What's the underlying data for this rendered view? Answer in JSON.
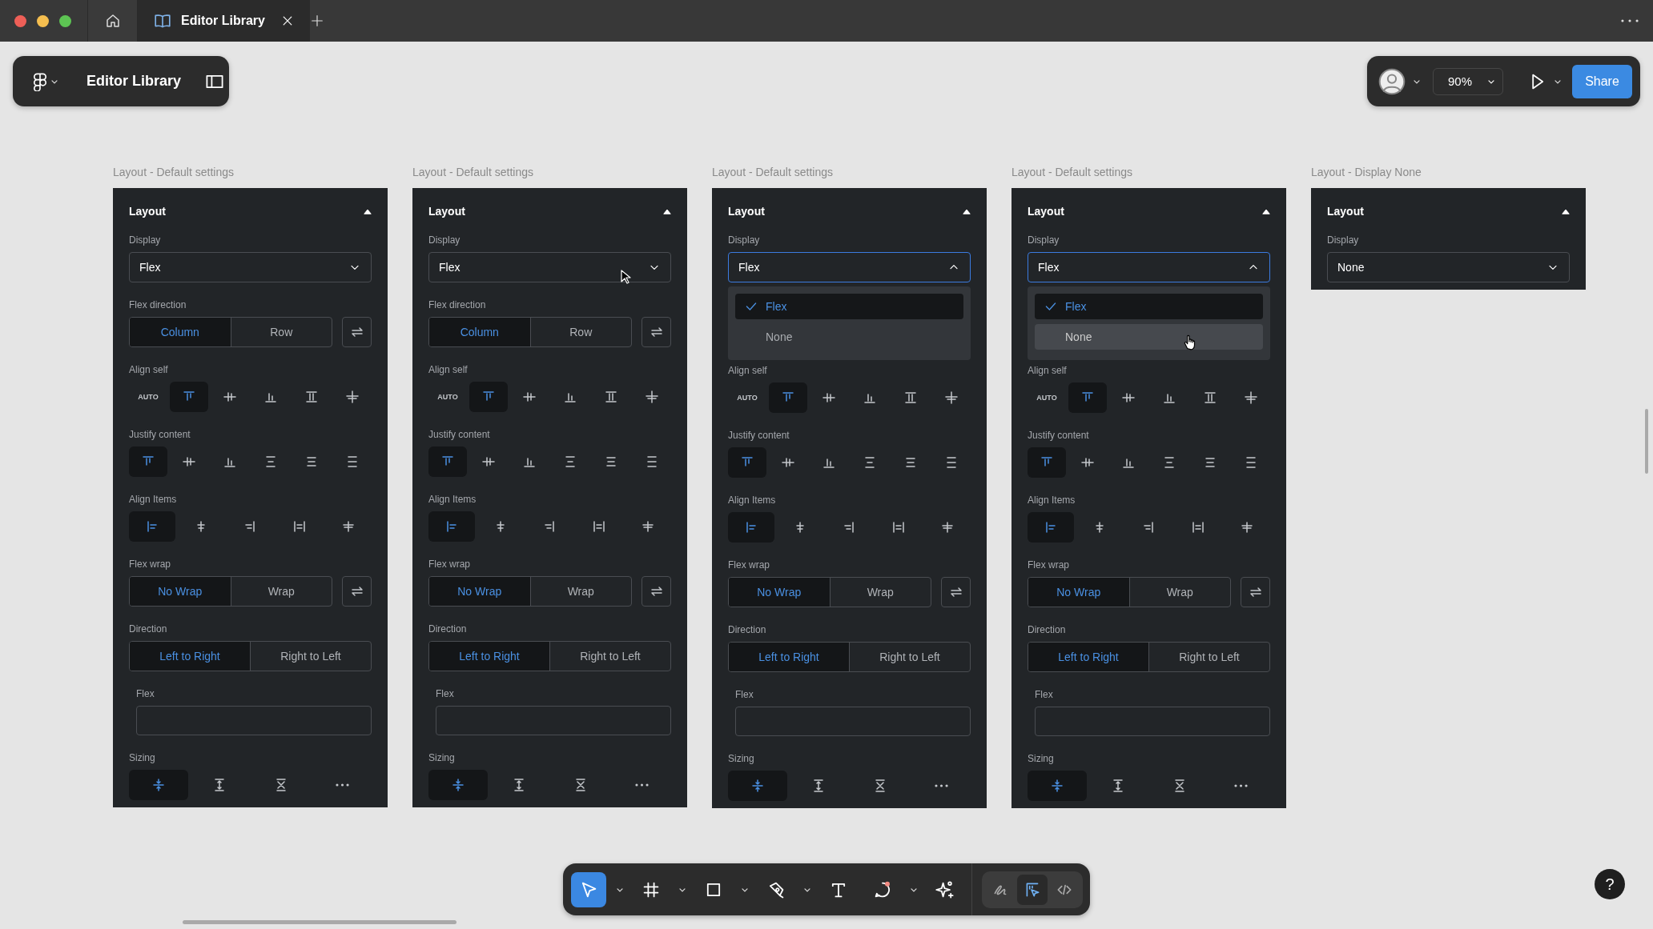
{
  "browser_tabs": [
    {
      "kind": "home",
      "selected": false
    },
    {
      "kind": "file",
      "label": "Editor Library",
      "selected": true
    }
  ],
  "file_bar": {
    "title": "Editor Library"
  },
  "share_bar": {
    "zoom": "90%",
    "share": "Share"
  },
  "panels": [
    {
      "caption": "Layout - Default settings",
      "title": "Layout",
      "expanded": true,
      "display": {
        "label": "Display",
        "value": "Flex",
        "open": false
      },
      "sections": [
        {
          "kind": "segmented",
          "label": "Flex direction",
          "swap": true,
          "options": [
            {
              "label": "Column",
              "selected": true
            },
            {
              "label": "Row",
              "selected": false
            }
          ]
        },
        {
          "kind": "icons",
          "label": "Align self",
          "items": [
            {
              "kind": "text",
              "label": "AUTO",
              "selected": false
            },
            {
              "kind": "align-top",
              "selected": true
            },
            {
              "kind": "align-middle",
              "selected": false
            },
            {
              "kind": "align-bottom",
              "selected": false
            },
            {
              "kind": "stretch",
              "selected": false
            },
            {
              "kind": "baseline",
              "selected": false
            }
          ]
        },
        {
          "kind": "icons",
          "label": "Justify content",
          "items": [
            {
              "kind": "align-top",
              "selected": true
            },
            {
              "kind": "align-middle",
              "selected": false
            },
            {
              "kind": "align-bottom",
              "selected": false
            },
            {
              "kind": "space-between",
              "selected": false
            },
            {
              "kind": "space-around",
              "selected": false
            },
            {
              "kind": "space-evenly",
              "selected": false
            }
          ]
        },
        {
          "kind": "icons",
          "label": "Align Items",
          "items": [
            {
              "kind": "items-start",
              "selected": true
            },
            {
              "kind": "items-center",
              "selected": false
            },
            {
              "kind": "items-end",
              "selected": false
            },
            {
              "kind": "items-stretch",
              "selected": false
            },
            {
              "kind": "items-baseline",
              "selected": false
            }
          ]
        },
        {
          "kind": "segmented",
          "label": "Flex wrap",
          "swap": true,
          "options": [
            {
              "label": "No Wrap",
              "selected": true
            },
            {
              "label": "Wrap",
              "selected": false
            }
          ]
        },
        {
          "kind": "segmented",
          "label": "Direction",
          "swap": false,
          "options": [
            {
              "label": "Left to Right",
              "selected": true
            },
            {
              "label": "Right to Left",
              "selected": false
            }
          ]
        },
        {
          "kind": "field",
          "label": "Flex"
        },
        {
          "kind": "icons",
          "label": "Sizing",
          "items": [
            {
              "kind": "size-fit",
              "selected": true
            },
            {
              "kind": "size-hug",
              "selected": false
            },
            {
              "kind": "size-fill",
              "selected": false
            },
            {
              "kind": "more",
              "selected": false
            }
          ]
        }
      ]
    },
    {
      "caption": "Layout - Default settings",
      "title": "Layout",
      "expanded": true,
      "display": {
        "label": "Display",
        "value": "Flex",
        "open": false,
        "hovered": true
      },
      "sections": [
        {
          "kind": "segmented",
          "label": "Flex direction",
          "swap": true,
          "options": [
            {
              "label": "Column",
              "selected": true
            },
            {
              "label": "Row",
              "selected": false
            }
          ]
        },
        {
          "kind": "icons",
          "label": "Align self",
          "items": [
            {
              "kind": "text",
              "label": "AUTO",
              "selected": false
            },
            {
              "kind": "align-top",
              "selected": true
            },
            {
              "kind": "align-middle",
              "selected": false
            },
            {
              "kind": "align-bottom",
              "selected": false
            },
            {
              "kind": "stretch",
              "selected": false
            },
            {
              "kind": "baseline",
              "selected": false
            }
          ]
        },
        {
          "kind": "icons",
          "label": "Justify content",
          "items": [
            {
              "kind": "align-top",
              "selected": true
            },
            {
              "kind": "align-middle",
              "selected": false
            },
            {
              "kind": "align-bottom",
              "selected": false
            },
            {
              "kind": "space-between",
              "selected": false
            },
            {
              "kind": "space-around",
              "selected": false
            },
            {
              "kind": "space-evenly",
              "selected": false
            }
          ]
        },
        {
          "kind": "icons",
          "label": "Align Items",
          "items": [
            {
              "kind": "items-start",
              "selected": true
            },
            {
              "kind": "items-center",
              "selected": false
            },
            {
              "kind": "items-end",
              "selected": false
            },
            {
              "kind": "items-stretch",
              "selected": false
            },
            {
              "kind": "items-baseline",
              "selected": false
            }
          ]
        },
        {
          "kind": "segmented",
          "label": "Flex wrap",
          "swap": true,
          "options": [
            {
              "label": "No Wrap",
              "selected": true
            },
            {
              "label": "Wrap",
              "selected": false
            }
          ]
        },
        {
          "kind": "segmented",
          "label": "Direction",
          "swap": false,
          "options": [
            {
              "label": "Left to Right",
              "selected": true
            },
            {
              "label": "Right to Left",
              "selected": false
            }
          ]
        },
        {
          "kind": "field",
          "label": "Flex"
        },
        {
          "kind": "icons",
          "label": "Sizing",
          "items": [
            {
              "kind": "size-fit",
              "selected": true
            },
            {
              "kind": "size-hug",
              "selected": false
            },
            {
              "kind": "size-fill",
              "selected": false
            },
            {
              "kind": "more",
              "selected": false
            }
          ]
        }
      ]
    },
    {
      "caption": "Layout - Default settings",
      "title": "Layout",
      "expanded": true,
      "display": {
        "label": "Display",
        "value": "Flex",
        "open": true,
        "options": [
          {
            "label": "Flex",
            "selected": true,
            "hovered": false
          },
          {
            "label": "None",
            "selected": false,
            "hovered": false
          }
        ]
      },
      "sections": [
        {
          "kind": "icons",
          "label": "Align self",
          "items": [
            {
              "kind": "text",
              "label": "AUTO",
              "selected": false
            },
            {
              "kind": "align-top",
              "selected": true
            },
            {
              "kind": "align-middle",
              "selected": false
            },
            {
              "kind": "align-bottom",
              "selected": false
            },
            {
              "kind": "stretch",
              "selected": false
            },
            {
              "kind": "baseline",
              "selected": false
            }
          ]
        },
        {
          "kind": "icons",
          "label": "Justify content",
          "items": [
            {
              "kind": "align-top",
              "selected": true
            },
            {
              "kind": "align-middle",
              "selected": false
            },
            {
              "kind": "align-bottom",
              "selected": false
            },
            {
              "kind": "space-between",
              "selected": false
            },
            {
              "kind": "space-around",
              "selected": false
            },
            {
              "kind": "space-evenly",
              "selected": false
            }
          ]
        },
        {
          "kind": "icons",
          "label": "Align Items",
          "items": [
            {
              "kind": "items-start",
              "selected": true
            },
            {
              "kind": "items-center",
              "selected": false
            },
            {
              "kind": "items-end",
              "selected": false
            },
            {
              "kind": "items-stretch",
              "selected": false
            },
            {
              "kind": "items-baseline",
              "selected": false
            }
          ]
        },
        {
          "kind": "segmented",
          "label": "Flex wrap",
          "swap": true,
          "options": [
            {
              "label": "No Wrap",
              "selected": true
            },
            {
              "label": "Wrap",
              "selected": false
            }
          ]
        },
        {
          "kind": "segmented",
          "label": "Direction",
          "swap": false,
          "options": [
            {
              "label": "Left to Right",
              "selected": true
            },
            {
              "label": "Right to Left",
              "selected": false
            }
          ]
        },
        {
          "kind": "field",
          "label": "Flex"
        },
        {
          "kind": "icons",
          "label": "Sizing",
          "items": [
            {
              "kind": "size-fit",
              "selected": true
            },
            {
              "kind": "size-hug",
              "selected": false
            },
            {
              "kind": "size-fill",
              "selected": false
            },
            {
              "kind": "more",
              "selected": false
            }
          ]
        }
      ]
    },
    {
      "caption": "Layout - Default settings",
      "title": "Layout",
      "expanded": true,
      "display": {
        "label": "Display",
        "value": "Flex",
        "open": true,
        "options": [
          {
            "label": "Flex",
            "selected": true,
            "hovered": false
          },
          {
            "label": "None",
            "selected": false,
            "hovered": true
          }
        ]
      },
      "sections": [
        {
          "kind": "icons",
          "label": "Align self",
          "items": [
            {
              "kind": "text",
              "label": "AUTO",
              "selected": false
            },
            {
              "kind": "align-top",
              "selected": true
            },
            {
              "kind": "align-middle",
              "selected": false
            },
            {
              "kind": "align-bottom",
              "selected": false
            },
            {
              "kind": "stretch",
              "selected": false
            },
            {
              "kind": "baseline",
              "selected": false
            }
          ]
        },
        {
          "kind": "icons",
          "label": "Justify content",
          "items": [
            {
              "kind": "align-top",
              "selected": true
            },
            {
              "kind": "align-middle",
              "selected": false
            },
            {
              "kind": "align-bottom",
              "selected": false
            },
            {
              "kind": "space-between",
              "selected": false
            },
            {
              "kind": "space-around",
              "selected": false
            },
            {
              "kind": "space-evenly",
              "selected": false
            }
          ]
        },
        {
          "kind": "icons",
          "label": "Align Items",
          "items": [
            {
              "kind": "items-start",
              "selected": true
            },
            {
              "kind": "items-center",
              "selected": false
            },
            {
              "kind": "items-end",
              "selected": false
            },
            {
              "kind": "items-stretch",
              "selected": false
            },
            {
              "kind": "items-baseline",
              "selected": false
            }
          ]
        },
        {
          "kind": "segmented",
          "label": "Flex wrap",
          "swap": true,
          "options": [
            {
              "label": "No Wrap",
              "selected": true
            },
            {
              "label": "Wrap",
              "selected": false
            }
          ]
        },
        {
          "kind": "segmented",
          "label": "Direction",
          "swap": false,
          "options": [
            {
              "label": "Left to Right",
              "selected": true
            },
            {
              "label": "Right to Left",
              "selected": false
            }
          ]
        },
        {
          "kind": "field",
          "label": "Flex"
        },
        {
          "kind": "icons",
          "label": "Sizing",
          "items": [
            {
              "kind": "size-fit",
              "selected": true
            },
            {
              "kind": "size-hug",
              "selected": false
            },
            {
              "kind": "size-fill",
              "selected": false
            },
            {
              "kind": "more",
              "selected": false
            }
          ]
        }
      ]
    },
    {
      "caption": "Layout - Display None",
      "title": "Layout",
      "expanded": true,
      "display": {
        "label": "Display",
        "value": "None",
        "open": false
      }
    }
  ],
  "toolbar": {
    "tools": [
      {
        "kind": "move",
        "selected": true,
        "menu": true
      },
      {
        "kind": "frame",
        "selected": false,
        "menu": true
      },
      {
        "kind": "rectangle",
        "selected": false,
        "menu": true
      },
      {
        "kind": "pen",
        "selected": false,
        "menu": true
      },
      {
        "kind": "text",
        "selected": false,
        "menu": false
      },
      {
        "kind": "comment",
        "selected": false,
        "menu": true
      },
      {
        "kind": "ai",
        "selected": false,
        "menu": false
      }
    ],
    "modes": [
      {
        "kind": "draw",
        "selected": false
      },
      {
        "kind": "design",
        "selected": true
      },
      {
        "kind": "dev",
        "selected": false
      }
    ]
  },
  "help": "?"
}
